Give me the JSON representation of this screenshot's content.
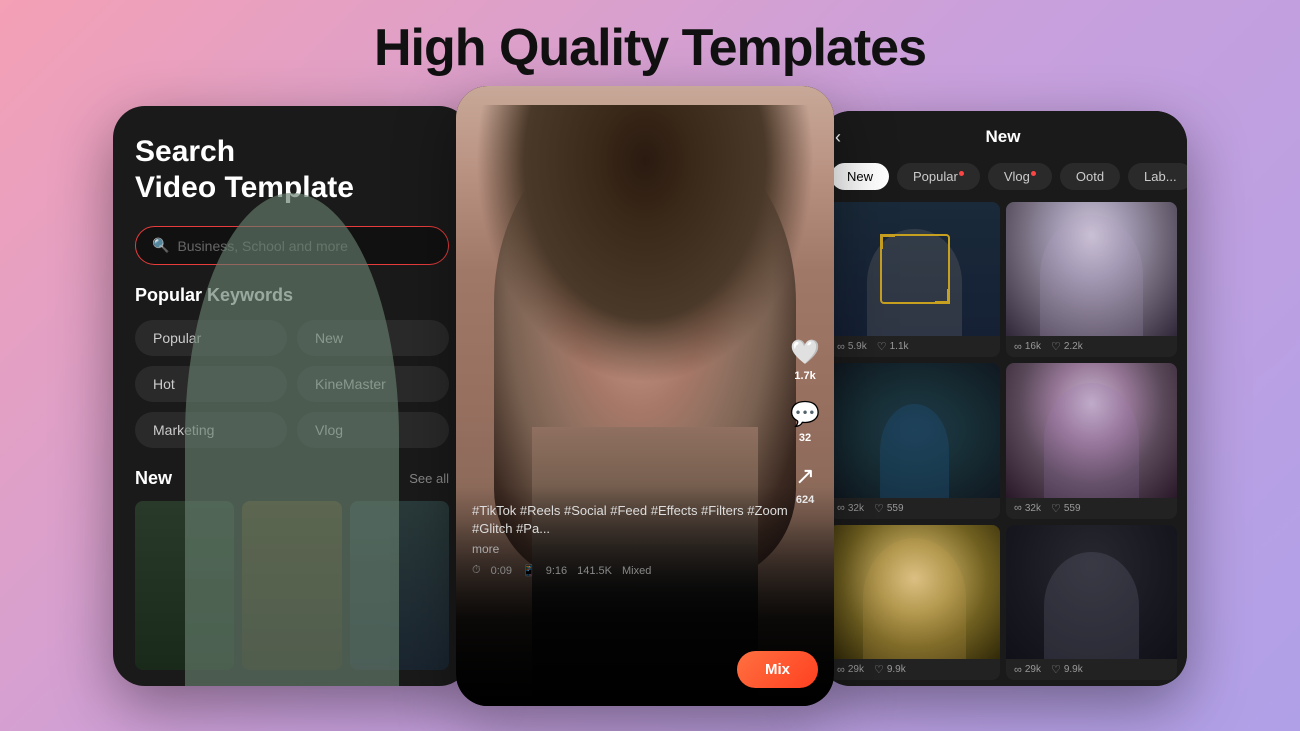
{
  "page": {
    "title": "High Quality Templates",
    "background": "linear-gradient(135deg, #f4a0b5 0%, #c9a0dc 50%, #b0a0e8 100%)"
  },
  "left_phone": {
    "search_title": "Search\nVideo Template",
    "search_placeholder": "Business, School and more",
    "popular_keywords_label": "Popular Keywords",
    "keywords": [
      "Popular",
      "New",
      "Hot",
      "KineMarster",
      "Marketing",
      "Vlog"
    ],
    "new_section_label": "New",
    "see_all_label": "See all"
  },
  "center_phone": {
    "hashtags": "#TikTok #Reels #Social #Feed\n#Effects #Filters #Zoom #Glitch #Pa...",
    "more_label": "more",
    "duration": "0:09",
    "aspect_ratio": "9:16",
    "views": "141.5K",
    "type": "Mixed",
    "mix_button": "Mix",
    "like_count": "1.7k",
    "comment_count": "32",
    "share_count": "624"
  },
  "right_phone": {
    "header_title": "New",
    "back_icon": "‹",
    "tabs": [
      {
        "label": "New",
        "active": true,
        "dot": false
      },
      {
        "label": "Popular",
        "active": false,
        "dot": true
      },
      {
        "label": "Vlog",
        "active": false,
        "dot": true
      },
      {
        "label": "Ootd",
        "active": false,
        "dot": false
      },
      {
        "label": "Label",
        "active": false,
        "dot": false
      }
    ],
    "thumbnails": [
      {
        "stats": {
          "views": "5.9k",
          "likes": "1.1k"
        }
      },
      {
        "stats": {
          "views": "16k",
          "likes": "2.2k"
        }
      },
      {
        "stats": {
          "views": "32k",
          "likes": "559"
        }
      },
      {
        "stats": {
          "views": "32k",
          "likes": "559"
        }
      },
      {
        "stats": {
          "views": "29k",
          "likes": "9.9k"
        }
      },
      {
        "stats": {
          "views": "",
          "likes": ""
        }
      }
    ]
  }
}
